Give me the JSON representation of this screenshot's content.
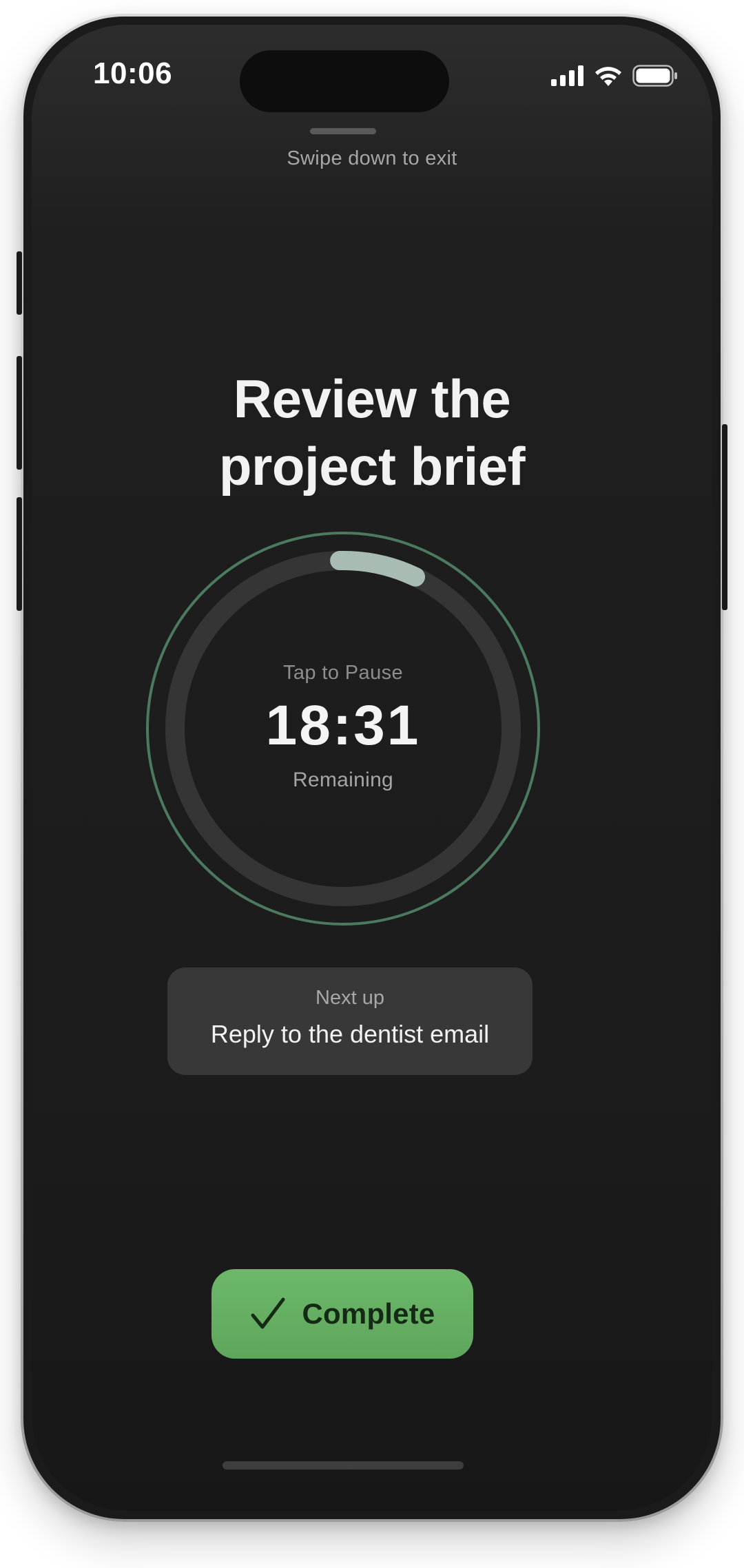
{
  "status_bar": {
    "time": "10:06",
    "icons": [
      "cellular-signal-icon",
      "wifi-icon",
      "battery-icon"
    ]
  },
  "hint": {
    "swipe_text": "Swipe down to exit"
  },
  "task": {
    "title_line1": "Review the",
    "title_line2": "project brief"
  },
  "timer": {
    "tap_label": "Tap to Pause",
    "time_remaining": "18:31",
    "remaining_label": "Remaining",
    "progress_fraction": 0.074,
    "colors": {
      "outer_ring": "#4c7a5f",
      "track": "#353535",
      "progress": "#a9bcb3"
    }
  },
  "next_up": {
    "label": "Next up",
    "task": "Reply to the dentist email"
  },
  "actions": {
    "complete_label": "Complete",
    "complete_icon": "checkmark-icon",
    "accent_color": "#66b062"
  }
}
